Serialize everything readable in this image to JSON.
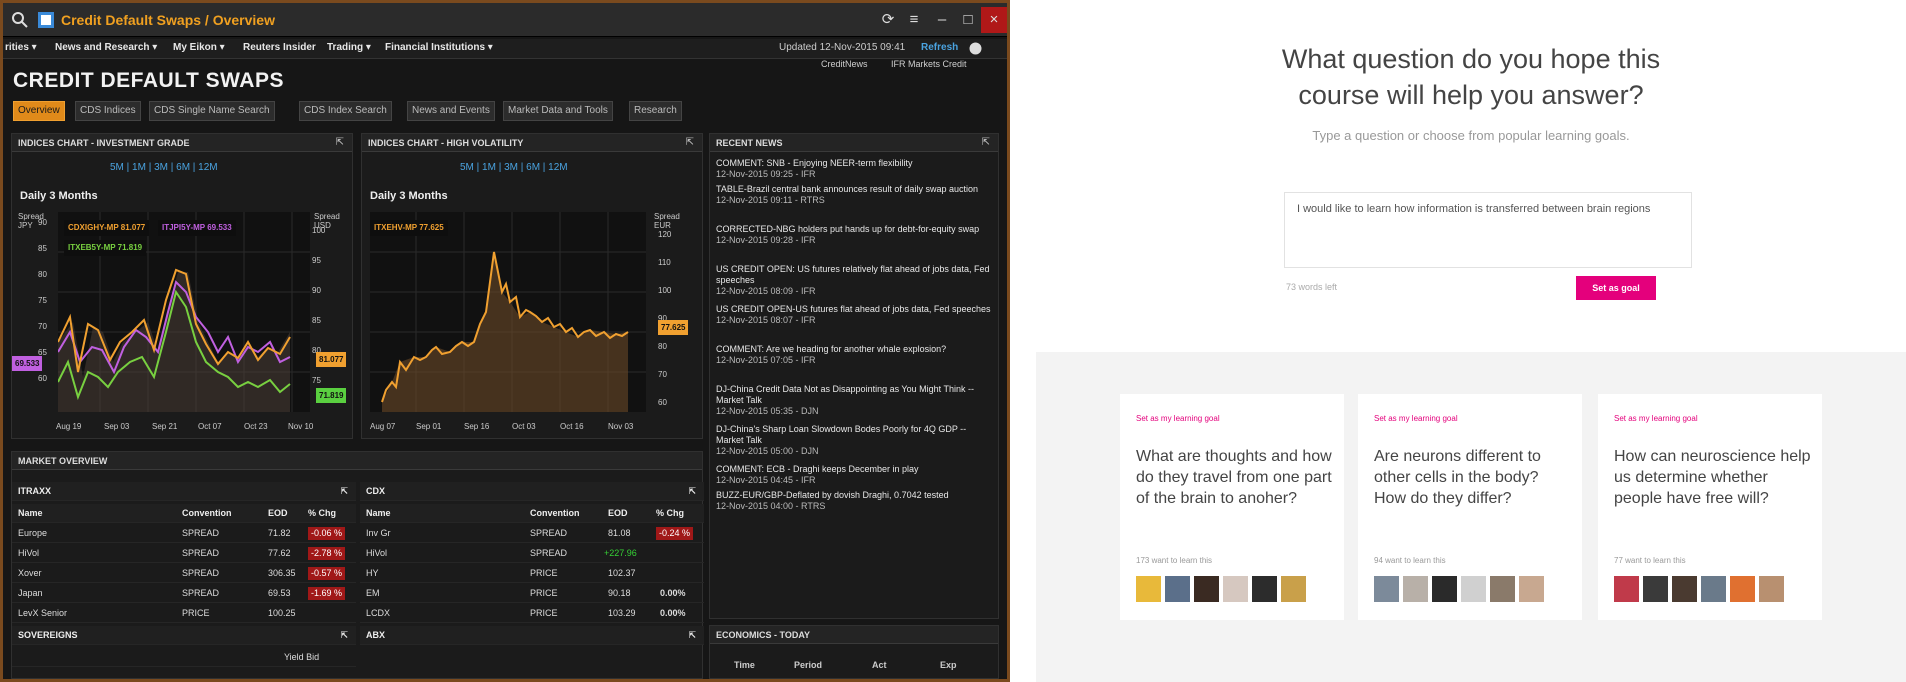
{
  "terminal": {
    "window_title": "Credit Default Swaps / Overview",
    "win_buttons": [
      "⟳",
      "≡",
      "–",
      "□",
      "×"
    ],
    "menu": [
      "rities ▾",
      "News and Research ▾",
      "My Eikon ▾",
      "Reuters Insider",
      "Trading ▾",
      "Financial Institutions ▾"
    ],
    "updated": "Updated 12-Nov-2015 09:41",
    "refresh": "Refresh",
    "sources": [
      "CreditNews",
      "IFR Markets Credit"
    ],
    "page_title": "CREDIT DEFAULT SWAPS",
    "tabs": [
      "Overview",
      "CDS Indices",
      "CDS Single Name Search",
      "CDS Index Search",
      "News and Events",
      "Market Data and Tools",
      "Research"
    ],
    "chart1": {
      "title": "INDICES CHART - INVESTMENT GRADE",
      "periods": "5M | 1M | 3M | 6M | 12M",
      "subtitle": "Daily 3 Months",
      "left_axis": "Spread JPY",
      "right_axis": "Spread USD",
      "legend": [
        "CDXIGHY-MP 81.077",
        "ITXEB5Y-MP 71.819",
        "ITJPI5Y-MP 69.533"
      ],
      "yticks_left": [
        "90",
        "85",
        "80",
        "75",
        "70",
        "65",
        "60"
      ],
      "yticks_right": [
        "100",
        "95",
        "90",
        "85",
        "80",
        "75"
      ],
      "xticks": [
        "Aug 19",
        "Sep 03",
        "Sep 21",
        "Oct 07",
        "Oct 23",
        "Nov 10"
      ],
      "flags": [
        "69.533",
        "81.077",
        "71.819"
      ]
    },
    "chart2": {
      "title": "INDICES CHART - HIGH VOLATILITY",
      "periods": "5M | 1M | 3M | 6M | 12M",
      "subtitle": "Daily 3 Months",
      "right_axis": "Spread EUR",
      "legend": [
        "ITXEHV-MP 77.625"
      ],
      "yticks": [
        "120",
        "110",
        "100",
        "90",
        "80",
        "70",
        "60"
      ],
      "xticks": [
        "Aug 07",
        "Sep 01",
        "Sep 16",
        "Oct 03",
        "Oct 16",
        "Nov 03"
      ],
      "flag": "77.625"
    },
    "news": {
      "title": "RECENT NEWS",
      "items": [
        {
          "h": "COMMENT: SNB - Enjoying NEER-term flexibility",
          "d": "12-Nov-2015 09:25 - IFR"
        },
        {
          "h": "TABLE-Brazil central bank announces result of daily swap auction",
          "d": "12-Nov-2015 09:11 - RTRS"
        },
        {
          "h": "CORRECTED-NBG holders put hands up for debt-for-equity swap",
          "d": "12-Nov-2015 09:28 - IFR"
        },
        {
          "h": "US CREDIT OPEN: US futures relatively flat ahead of jobs data, Fed speeches",
          "d": "12-Nov-2015 08:09 - IFR"
        },
        {
          "h": "US CREDIT OPEN-US futures flat ahead of jobs data, Fed speeches",
          "d": "12-Nov-2015 08:07 - IFR"
        },
        {
          "h": "COMMENT: Are we heading for another whale explosion?",
          "d": "12-Nov-2015 07:05 - IFR"
        },
        {
          "h": "DJ-China Credit Data Not as Disappointing as You Might Think -- Market Talk",
          "d": "12-Nov-2015 05:35 - DJN"
        },
        {
          "h": "DJ-China's Sharp Loan Slowdown Bodes Poorly for 4Q GDP -- Market Talk",
          "d": "12-Nov-2015 05:00 - DJN"
        },
        {
          "h": "COMMENT: ECB - Draghi keeps December in play",
          "d": "12-Nov-2015 04:45 - IFR"
        },
        {
          "h": "BUZZ-EUR/GBP-Deflated by dovish Draghi, 0.7042 tested",
          "d": "12-Nov-2015 04:00 - RTRS"
        }
      ]
    },
    "market_overview": "MARKET OVERVIEW",
    "itraxx": {
      "title": "ITRAXX",
      "headers": [
        "Name",
        "Convention",
        "EOD",
        "% Chg"
      ],
      "rows": [
        [
          "Europe",
          "SPREAD",
          "71.82",
          "-0.06 %"
        ],
        [
          "HiVol",
          "SPREAD",
          "77.62",
          "-2.78 %"
        ],
        [
          "Xover",
          "SPREAD",
          "306.35",
          "-0.57 %"
        ],
        [
          "Japan",
          "SPREAD",
          "69.53",
          "-1.69 %"
        ],
        [
          "LevX Senior",
          "PRICE",
          "100.25",
          ""
        ]
      ]
    },
    "cdx": {
      "title": "CDX",
      "headers": [
        "Name",
        "Convention",
        "EOD",
        "% Chg"
      ],
      "rows": [
        [
          "Inv Gr",
          "SPREAD",
          "81.08",
          "-0.24 %"
        ],
        [
          "HiVol",
          "SPREAD",
          "+227.96",
          ""
        ],
        [
          "HY",
          "PRICE",
          "102.37",
          ""
        ],
        [
          "EM",
          "PRICE",
          "90.18",
          "0.00%"
        ],
        [
          "LCDX",
          "PRICE",
          "103.29",
          "0.00%"
        ]
      ]
    },
    "sovereigns": "SOVEREIGNS",
    "abx": "ABX",
    "yield_bid": "Yield Bid",
    "economics": {
      "title": "ECONOMICS - TODAY",
      "headers": [
        "Time",
        "Period",
        "Act",
        "Exp"
      ]
    }
  },
  "course": {
    "question_lines": [
      "What question do you hope this",
      "course will help you answer?"
    ],
    "hint": "Type a question or choose from popular learning goals.",
    "input_value": "I would like to learn how information is transferred between brain regions",
    "words_left": "73 words left",
    "set_goal": "Set as goal",
    "cards": [
      {
        "tag": "Set as my learning goal",
        "title": "What are thoughts and how do they travel from one part of the brain to anoher?",
        "count": "173 want to learn this"
      },
      {
        "tag": "Set as my learning goal",
        "title": "Are neurons different  to other cells in the body? How do they differ?",
        "count": "94 want to learn this"
      },
      {
        "tag": "Set as my learning goal",
        "title": "How can neuroscience help us determine whether people have free will?",
        "count": "77 want to learn this"
      }
    ],
    "avatar_colors": [
      [
        "#e8b93a",
        "#5b6f8a",
        "#3a2a22",
        "#d6c8c0",
        "#2c2c2c",
        "#c9a04a"
      ],
      [
        "#7c8a9a",
        "#b8b0a8",
        "#2a2a2a",
        "#d0d0d0",
        "#8a7a6a",
        "#c8a890"
      ],
      [
        "#c03a4a",
        "#3a3a3a",
        "#4a3a30",
        "#6a7a8a",
        "#e07030",
        "#b89070"
      ]
    ]
  }
}
